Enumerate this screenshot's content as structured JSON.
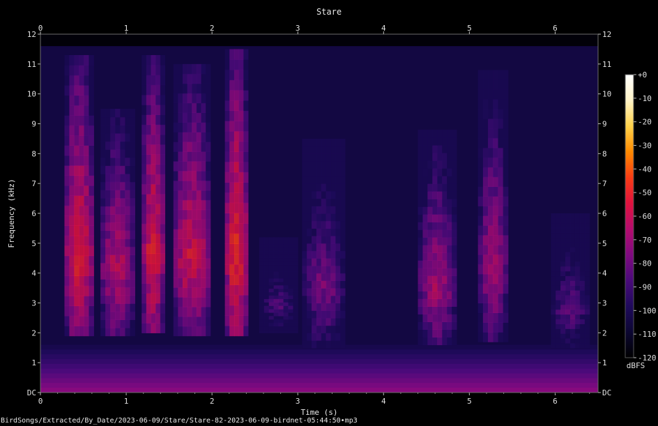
{
  "chart_data": {
    "type": "heatmap",
    "title": "Stare",
    "xlabel": "Time (s)",
    "ylabel": "Frequency (kHz)",
    "xlim": [
      0,
      6.5
    ],
    "ylim": [
      0,
      12
    ],
    "x_ticks": [
      "0",
      "1",
      "2",
      "3",
      "4",
      "5",
      "6"
    ],
    "y_ticks": [
      "DC",
      "1",
      "2",
      "3",
      "4",
      "5",
      "6",
      "7",
      "8",
      "9",
      "10",
      "11",
      "12"
    ],
    "colorbar": {
      "label": "dBFS",
      "range": [
        -120,
        0
      ],
      "ticks": [
        "+0",
        "-10",
        "-20",
        "-30",
        "-40",
        "-50",
        "-60",
        "-70",
        "-80",
        "-90",
        "-100",
        "-110",
        "-120"
      ],
      "colors": [
        "#000000",
        "#0c0732",
        "#1f0a5c",
        "#4a0a7a",
        "#800a80",
        "#b40c6e",
        "#e0123e",
        "#fa3c14",
        "#ff8a00",
        "#ffd24a",
        "#fff4c8",
        "#ffffff"
      ]
    },
    "energy_bands": [
      {
        "t_start": 0.28,
        "t_end": 0.62,
        "f_low": 1.9,
        "f_high": 11.3,
        "peak_dbfs": -50
      },
      {
        "t_start": 0.7,
        "t_end": 1.1,
        "f_low": 1.9,
        "f_high": 9.5,
        "peak_dbfs": -60
      },
      {
        "t_start": 1.18,
        "t_end": 1.45,
        "f_low": 2.0,
        "f_high": 11.3,
        "peak_dbfs": -50
      },
      {
        "t_start": 1.55,
        "t_end": 1.98,
        "f_low": 1.9,
        "f_high": 11.0,
        "peak_dbfs": -55
      },
      {
        "t_start": 2.15,
        "t_end": 2.42,
        "f_low": 1.9,
        "f_high": 11.5,
        "peak_dbfs": -45
      },
      {
        "t_start": 2.55,
        "t_end": 3.0,
        "f_low": 2.0,
        "f_high": 5.2,
        "peak_dbfs": -85
      },
      {
        "t_start": 3.05,
        "t_end": 3.55,
        "f_low": 1.5,
        "f_high": 8.5,
        "peak_dbfs": -75
      },
      {
        "t_start": 4.4,
        "t_end": 4.85,
        "f_low": 1.6,
        "f_high": 8.8,
        "peak_dbfs": -65
      },
      {
        "t_start": 5.1,
        "t_end": 5.45,
        "f_low": 1.7,
        "f_high": 10.8,
        "peak_dbfs": -65
      },
      {
        "t_start": 5.95,
        "t_end": 6.4,
        "f_low": 1.5,
        "f_high": 6.0,
        "peak_dbfs": -80
      }
    ],
    "background_dbfs": -105,
    "low_frequency_floor": {
      "f_low": 0,
      "f_high": 1.6,
      "peak_dbfs": -75
    }
  },
  "footer": {
    "source_path": "BirdSongs/Extracted/By_Date/2023-06-09/Stare/Stare-82-2023-06-09-birdnet-05:44:50•mp3"
  }
}
